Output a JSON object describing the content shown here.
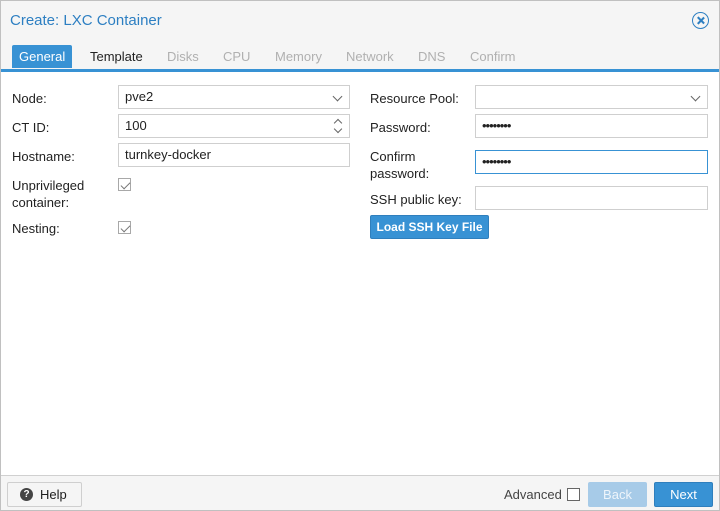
{
  "window": {
    "title": "Create: LXC Container"
  },
  "tabs": [
    {
      "label": "General",
      "state": "active"
    },
    {
      "label": "Template",
      "state": "enabled"
    },
    {
      "label": "Disks",
      "state": "disabled"
    },
    {
      "label": "CPU",
      "state": "disabled"
    },
    {
      "label": "Memory",
      "state": "disabled"
    },
    {
      "label": "Network",
      "state": "disabled"
    },
    {
      "label": "DNS",
      "state": "disabled"
    },
    {
      "label": "Confirm",
      "state": "disabled"
    }
  ],
  "form": {
    "node": {
      "label": "Node:",
      "value": "pve2"
    },
    "ctid": {
      "label": "CT ID:",
      "value": "100"
    },
    "hostname": {
      "label": "Hostname:",
      "value": "turnkey-docker"
    },
    "unprivileged": {
      "label_line1": "Unprivileged",
      "label_line2": "container:",
      "checked": true
    },
    "nesting": {
      "label": "Nesting:",
      "checked": true
    },
    "resource_pool": {
      "label": "Resource Pool:",
      "value": ""
    },
    "password": {
      "label": "Password:",
      "value": "••••••••"
    },
    "confirm_password": {
      "label_line1": "Confirm",
      "label_line2": "password:",
      "value": "••••••••"
    },
    "ssh_key": {
      "label": "SSH public key:",
      "value": ""
    },
    "load_ssh_button": "Load SSH Key File"
  },
  "footer": {
    "help_label": "Help",
    "advanced_label": "Advanced",
    "advanced_checked": false,
    "back_label": "Back",
    "next_label": "Next"
  },
  "colors": {
    "accent": "#3892d4",
    "title": "#2d7fc2",
    "disabled_button": "#a7cbe8"
  }
}
